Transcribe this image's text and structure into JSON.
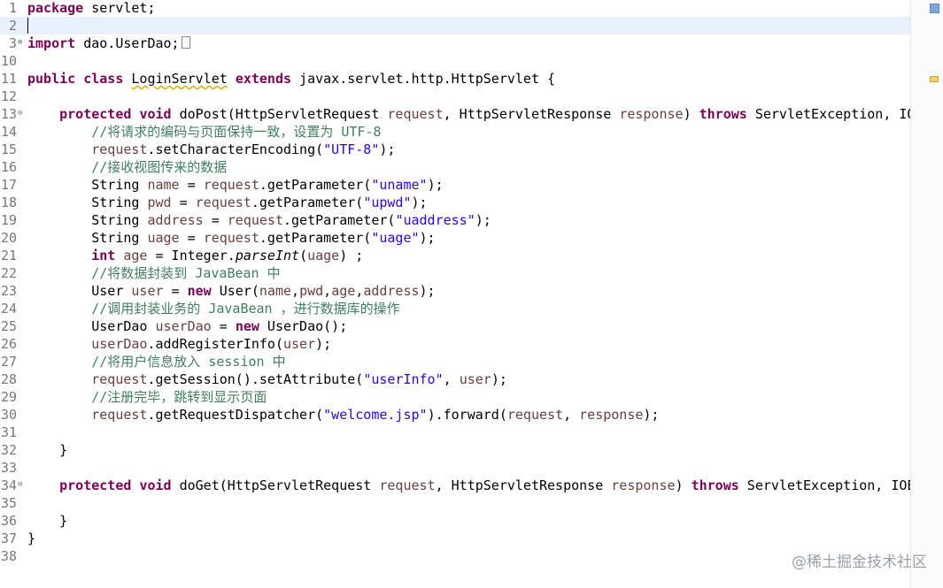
{
  "editor": {
    "lines": [
      {
        "n": "1",
        "tokens": [
          [
            "kw",
            "package"
          ],
          [
            "t",
            " servlet;"
          ]
        ]
      },
      {
        "n": "2",
        "current": true,
        "tokens": []
      },
      {
        "n": "3",
        "fold": "⊕",
        "tokens": [
          [
            "kw",
            "import"
          ],
          [
            "t",
            " dao.UserDao;"
          ]
        ],
        "box": true
      },
      {
        "n": "10",
        "tokens": []
      },
      {
        "n": "11",
        "tokens": [
          [
            "kw",
            "public"
          ],
          [
            "t",
            " "
          ],
          [
            "kw",
            "class"
          ],
          [
            "t",
            " "
          ],
          [
            "squig",
            "LoginServlet"
          ],
          [
            "t",
            " "
          ],
          [
            "kw",
            "extends"
          ],
          [
            "t",
            " javax.servlet.http.HttpServlet {"
          ]
        ]
      },
      {
        "n": "12",
        "tokens": []
      },
      {
        "n": "13",
        "fold": "⊖",
        "tokens": [
          [
            "t",
            "    "
          ],
          [
            "kw",
            "protected"
          ],
          [
            "t",
            " "
          ],
          [
            "kw",
            "void"
          ],
          [
            "t",
            " doPost(HttpServletRequest "
          ],
          [
            "var",
            "request"
          ],
          [
            "t",
            ", HttpServletResponse "
          ],
          [
            "var",
            "response"
          ],
          [
            "t",
            ") "
          ],
          [
            "kw",
            "throws"
          ],
          [
            "t",
            " ServletException, IOException {"
          ]
        ]
      },
      {
        "n": "14",
        "tokens": [
          [
            "t",
            "        "
          ],
          [
            "cmt",
            "//将请求的编码与页面保持一致，设置为 UTF-8"
          ]
        ]
      },
      {
        "n": "15",
        "tokens": [
          [
            "t",
            "        "
          ],
          [
            "var",
            "request"
          ],
          [
            "t",
            ".setCharacterEncoding("
          ],
          [
            "str",
            "\"UTF-8\""
          ],
          [
            "t",
            ");"
          ]
        ]
      },
      {
        "n": "16",
        "tokens": [
          [
            "t",
            "        "
          ],
          [
            "cmt",
            "//接收视图传来的数据"
          ]
        ]
      },
      {
        "n": "17",
        "tokens": [
          [
            "t",
            "        String "
          ],
          [
            "var",
            "name"
          ],
          [
            "t",
            " = "
          ],
          [
            "var",
            "request"
          ],
          [
            "t",
            ".getParameter("
          ],
          [
            "str",
            "\"uname\""
          ],
          [
            "t",
            ");"
          ]
        ]
      },
      {
        "n": "18",
        "tokens": [
          [
            "t",
            "        String "
          ],
          [
            "var",
            "pwd"
          ],
          [
            "t",
            " = "
          ],
          [
            "var",
            "request"
          ],
          [
            "t",
            ".getParameter("
          ],
          [
            "str",
            "\"upwd\""
          ],
          [
            "t",
            ");"
          ]
        ]
      },
      {
        "n": "19",
        "tokens": [
          [
            "t",
            "        String "
          ],
          [
            "var",
            "address"
          ],
          [
            "t",
            " = "
          ],
          [
            "var",
            "request"
          ],
          [
            "t",
            ".getParameter("
          ],
          [
            "str",
            "\"uaddress\""
          ],
          [
            "t",
            ");"
          ]
        ]
      },
      {
        "n": "20",
        "tokens": [
          [
            "t",
            "        String "
          ],
          [
            "var",
            "uage"
          ],
          [
            "t",
            " = "
          ],
          [
            "var",
            "request"
          ],
          [
            "t",
            ".getParameter("
          ],
          [
            "str",
            "\"uage\""
          ],
          [
            "t",
            ");"
          ]
        ]
      },
      {
        "n": "21",
        "tokens": [
          [
            "t",
            "        "
          ],
          [
            "kw",
            "int"
          ],
          [
            "t",
            " "
          ],
          [
            "var",
            "age"
          ],
          [
            "t",
            " = Integer."
          ],
          [
            "it",
            "parseInt"
          ],
          [
            "t",
            "("
          ],
          [
            "var",
            "uage"
          ],
          [
            "t",
            ") ;"
          ]
        ]
      },
      {
        "n": "22",
        "tokens": [
          [
            "t",
            "        "
          ],
          [
            "cmt",
            "//将数据封装到 JavaBean 中"
          ]
        ]
      },
      {
        "n": "23",
        "tokens": [
          [
            "t",
            "        User "
          ],
          [
            "var",
            "user"
          ],
          [
            "t",
            " = "
          ],
          [
            "kw",
            "new"
          ],
          [
            "t",
            " User("
          ],
          [
            "var",
            "name"
          ],
          [
            "t",
            ","
          ],
          [
            "var",
            "pwd"
          ],
          [
            "t",
            ","
          ],
          [
            "var",
            "age"
          ],
          [
            "t",
            ","
          ],
          [
            "var",
            "address"
          ],
          [
            "t",
            ");"
          ]
        ]
      },
      {
        "n": "24",
        "tokens": [
          [
            "t",
            "        "
          ],
          [
            "cmt",
            "//调用封装业务的 JavaBean ，进行数据库的操作"
          ]
        ]
      },
      {
        "n": "25",
        "tokens": [
          [
            "t",
            "        UserDao "
          ],
          [
            "var",
            "userDao"
          ],
          [
            "t",
            " = "
          ],
          [
            "kw",
            "new"
          ],
          [
            "t",
            " UserDao();"
          ]
        ]
      },
      {
        "n": "26",
        "tokens": [
          [
            "t",
            "        "
          ],
          [
            "var",
            "userDao"
          ],
          [
            "t",
            ".addRegisterInfo("
          ],
          [
            "var",
            "user"
          ],
          [
            "t",
            ");"
          ]
        ]
      },
      {
        "n": "27",
        "tokens": [
          [
            "t",
            "        "
          ],
          [
            "cmt",
            "//将用户信息放入 session 中"
          ]
        ]
      },
      {
        "n": "28",
        "tokens": [
          [
            "t",
            "        "
          ],
          [
            "var",
            "request"
          ],
          [
            "t",
            ".getSession().setAttribute("
          ],
          [
            "str",
            "\"userInfo\""
          ],
          [
            "t",
            ", "
          ],
          [
            "var",
            "user"
          ],
          [
            "t",
            ");"
          ]
        ]
      },
      {
        "n": "29",
        "tokens": [
          [
            "t",
            "        "
          ],
          [
            "cmt",
            "//注册完毕，跳转到显示页面"
          ]
        ]
      },
      {
        "n": "30",
        "tokens": [
          [
            "t",
            "        "
          ],
          [
            "var",
            "request"
          ],
          [
            "t",
            ".getRequestDispatcher("
          ],
          [
            "str",
            "\"welcome.jsp\""
          ],
          [
            "t",
            ").forward("
          ],
          [
            "var",
            "request"
          ],
          [
            "t",
            ", "
          ],
          [
            "var",
            "response"
          ],
          [
            "t",
            ");"
          ]
        ]
      },
      {
        "n": "31",
        "tokens": []
      },
      {
        "n": "32",
        "tokens": [
          [
            "t",
            "    }"
          ]
        ]
      },
      {
        "n": "33",
        "tokens": []
      },
      {
        "n": "34",
        "fold": "⊖",
        "tokens": [
          [
            "t",
            "    "
          ],
          [
            "kw",
            "protected"
          ],
          [
            "t",
            " "
          ],
          [
            "kw",
            "void"
          ],
          [
            "t",
            " doGet(HttpServletRequest "
          ],
          [
            "var",
            "request"
          ],
          [
            "t",
            ", HttpServletResponse "
          ],
          [
            "var",
            "response"
          ],
          [
            "t",
            ") "
          ],
          [
            "kw",
            "throws"
          ],
          [
            "t",
            " ServletException, IOException {"
          ]
        ]
      },
      {
        "n": "35",
        "tokens": []
      },
      {
        "n": "36",
        "tokens": [
          [
            "t",
            "    }"
          ]
        ]
      },
      {
        "n": "37",
        "tokens": [
          [
            "t",
            "}"
          ]
        ]
      },
      {
        "n": "38",
        "tokens": []
      }
    ]
  },
  "watermark": "@稀土掘金技术社区",
  "colors": {
    "keyword": "#7f0055",
    "string": "#2a00ff",
    "comment": "#3f7f5f",
    "variable": "#6a3e3e",
    "current_line": "#e8f2fe"
  }
}
